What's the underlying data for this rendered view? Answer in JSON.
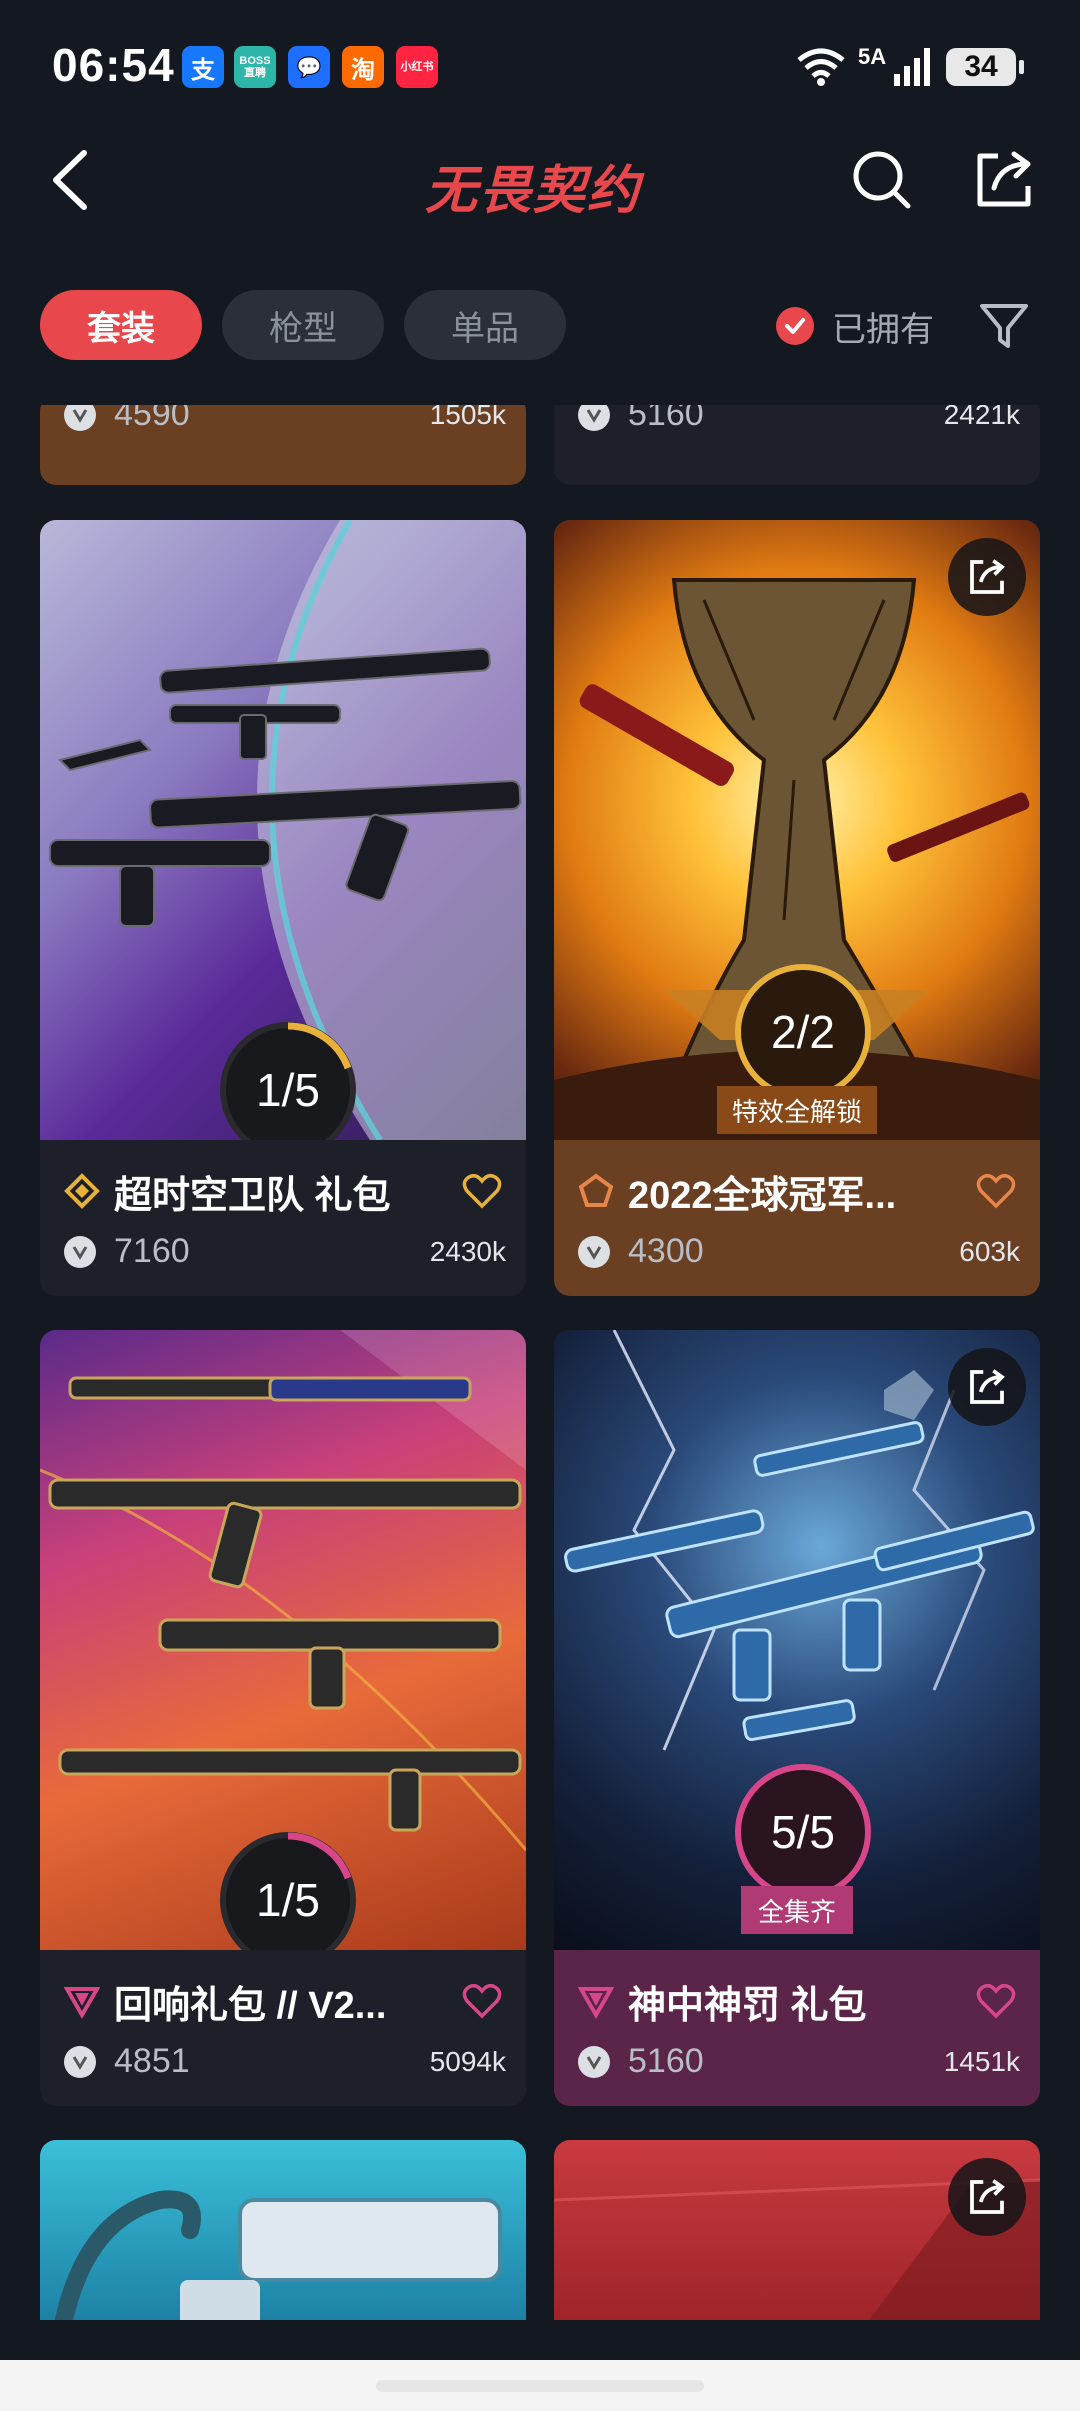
{
  "status_bar": {
    "time": "06:54",
    "apps": [
      {
        "label": "支",
        "color": "#1677ff"
      },
      {
        "label": "BOSS直聘",
        "color": "#2bb6a8"
      },
      {
        "label": "💬",
        "color": "#1e6fff"
      },
      {
        "label": "淘",
        "color": "#ff6a00"
      },
      {
        "label": "小红书",
        "color": "#ff2442"
      }
    ],
    "network": "5A",
    "battery": "34"
  },
  "header": {
    "logo": "无畏契约",
    "back_icon": "chevron-left-icon",
    "search_icon": "search-icon",
    "share_icon": "share-icon"
  },
  "filters": {
    "tabs": [
      {
        "label": "套装",
        "active": true
      },
      {
        "label": "枪型",
        "active": false
      },
      {
        "label": "单品",
        "active": false
      }
    ],
    "owned_label": "已拥有",
    "owned_checked": true
  },
  "cards": [
    {
      "name": "",
      "price": "4590",
      "count": "1505k",
      "progress": "",
      "badge": ""
    },
    {
      "name": "",
      "price": "5160",
      "count": "2421k",
      "progress": "",
      "badge": ""
    },
    {
      "name": "超时空卫队 礼包",
      "price": "7160",
      "count": "2430k",
      "progress": "1/5",
      "badge": "",
      "tier": "diamond",
      "theme": "dark"
    },
    {
      "name": "2022全球冠军...",
      "price": "4300",
      "count": "603k",
      "progress": "2/2",
      "badge": "特效全解锁",
      "tier": "pentagon",
      "theme": "orange"
    },
    {
      "name": "回响礼包 // V2...",
      "price": "4851",
      "count": "5094k",
      "progress": "1/5",
      "badge": "",
      "tier": "triangle",
      "theme": "dark"
    },
    {
      "name": "神中神罚 礼包",
      "price": "5160",
      "count": "1451k",
      "progress": "5/5",
      "badge": "全集齐",
      "tier": "triangle",
      "theme": "purple"
    }
  ],
  "colors": {
    "accent": "#e8474c",
    "background": "#141820",
    "card_dark": "#1d2029",
    "card_orange": "#6a3f22",
    "card_purple": "#5a2548",
    "gold": "#e8b23a",
    "pink": "#d8468a"
  }
}
